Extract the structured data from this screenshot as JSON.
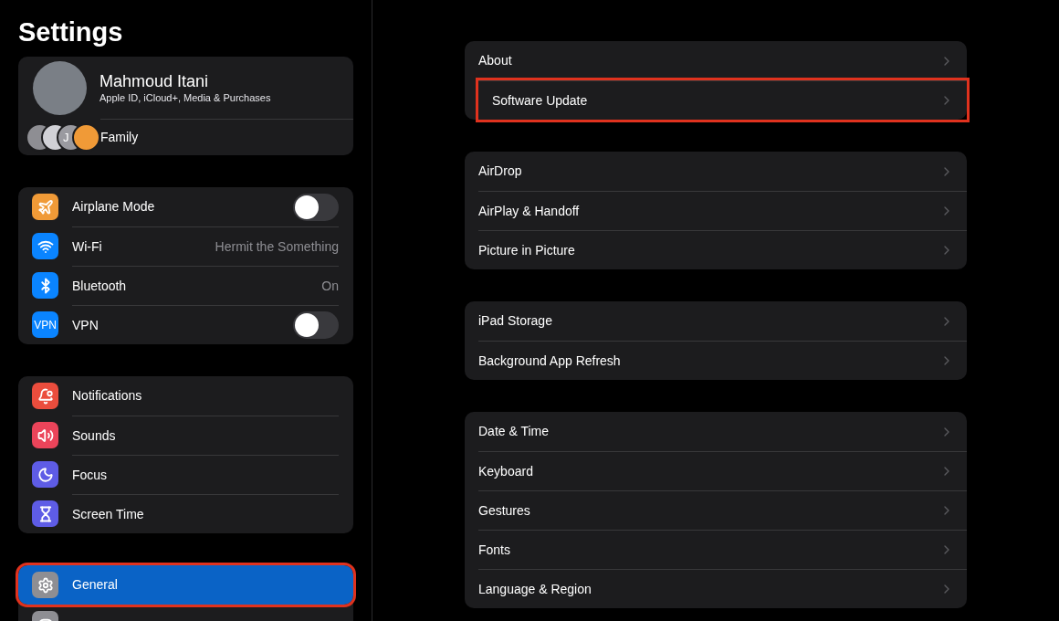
{
  "sidebar": {
    "title": "Settings",
    "account": {
      "name": "Mahmoud Itani",
      "subtitle": "Apple ID, iCloud+, Media & Purchases",
      "family_label": "Family",
      "family_avatars": [
        {
          "color": "#8e8e93"
        },
        {
          "color": "#d1d1d6"
        },
        {
          "initial": "J",
          "color": "#9a9aa0"
        },
        {
          "color": "#f09a37"
        }
      ]
    },
    "groups": [
      {
        "items": [
          {
            "color": "#f09a37",
            "label": "Airplane Mode",
            "kind": "toggle",
            "on": false,
            "selected": false,
            "highlighted": false
          },
          {
            "color": "#0a84ff",
            "label": "Wi-Fi",
            "kind": "value",
            "value": "Hermit the Something",
            "selected": false,
            "highlighted": false
          },
          {
            "color": "#0a84ff",
            "label": "Bluetooth",
            "kind": "value",
            "value": "On",
            "selected": false,
            "highlighted": false
          },
          {
            "icon_text": "VPN",
            "color": "#0a84ff",
            "label": "VPN",
            "kind": "toggle",
            "on": false,
            "selected": false,
            "highlighted": false
          }
        ]
      },
      {
        "items": [
          {
            "color": "#eb4d3d",
            "label": "Notifications",
            "kind": "link",
            "selected": false,
            "highlighted": false
          },
          {
            "color": "#eb445a",
            "label": "Sounds",
            "kind": "link",
            "selected": false,
            "highlighted": false
          },
          {
            "color": "#5e5ce6",
            "label": "Focus",
            "kind": "link",
            "selected": false,
            "highlighted": false
          },
          {
            "color": "#5e5ce6",
            "label": "Screen Time",
            "kind": "link",
            "selected": false,
            "highlighted": false
          }
        ]
      },
      {
        "items": [
          {
            "color": "#8e8e93",
            "label": "General",
            "kind": "link",
            "selected": true,
            "highlighted": true
          },
          {
            "color": "#8e8e93",
            "kind": "link",
            "selected": false,
            "highlighted": false
          }
        ]
      }
    ]
  },
  "detail": {
    "groups": [
      {
        "items": [
          {
            "label": "About",
            "highlighted": false
          },
          {
            "label": "Software Update",
            "highlighted": true
          }
        ]
      },
      {
        "items": [
          {
            "label": "AirDrop",
            "highlighted": false
          },
          {
            "label": "AirPlay & Handoff",
            "highlighted": false
          },
          {
            "label": "Picture in Picture",
            "highlighted": false
          }
        ]
      },
      {
        "items": [
          {
            "label": "iPad Storage",
            "highlighted": false
          },
          {
            "label": "Background App Refresh",
            "highlighted": false
          }
        ]
      },
      {
        "items": [
          {
            "label": "Date & Time",
            "highlighted": false
          },
          {
            "label": "Keyboard",
            "highlighted": false
          },
          {
            "label": "Gestures",
            "highlighted": false
          },
          {
            "label": "Fonts",
            "highlighted": false
          },
          {
            "label": "Language & Region",
            "highlighted": false
          }
        ]
      }
    ]
  }
}
